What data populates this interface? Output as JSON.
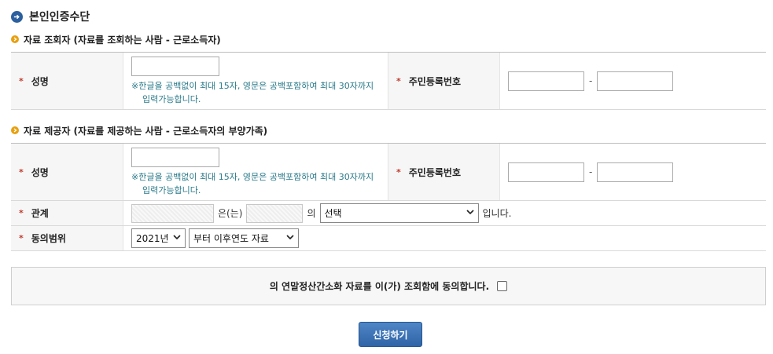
{
  "page": {
    "title": "본인인증수단"
  },
  "requester": {
    "section_title": "자료 조회자 (자료를 조회하는 사람 - 근로소득자)",
    "name_label": "성명",
    "name_value": "",
    "name_hint": "※한글을 공백없이 최대 15자, 영문은 공백포함하여 최대 30자까지 입력가능합니다.",
    "rrn_label": "주민등록번호",
    "rrn_front": "",
    "rrn_back": "",
    "rrn_separator": "-"
  },
  "provider": {
    "section_title": "자료 제공자 (자료를 제공하는 사람 - 근로소득자의 부양가족)",
    "name_label": "성명",
    "name_value": "",
    "name_hint": "※한글을 공백없이 최대 15자, 영문은 공백포함하여 최대 30자까지 입력가능합니다.",
    "rrn_label": "주민등록번호",
    "rrn_front": "",
    "rrn_back": "",
    "rrn_separator": "-",
    "relation_label": "관계",
    "relation_text1": "은(는)",
    "relation_text2": "의",
    "relation_select": "선택",
    "relation_suffix": "입니다.",
    "consent_label": "동의범위",
    "consent_year": "2021년",
    "consent_range": "부터 이후연도 자료"
  },
  "agree": {
    "text": "의 연말정산간소화 자료를 이(가) 조회함에 동의합니다.",
    "checked": false
  },
  "submit": {
    "label": "신청하기"
  },
  "colors": {
    "title_icon": "#2b5f9e",
    "section_icon": "#e8a010",
    "required_star": "#c0392b",
    "hint_text": "#2a7a8a",
    "button": "#3a6fb3"
  },
  "icons": {
    "title": "arrow-right-circle-icon",
    "section": "bullet-circle-icon",
    "select": "chevron-down-icon"
  }
}
